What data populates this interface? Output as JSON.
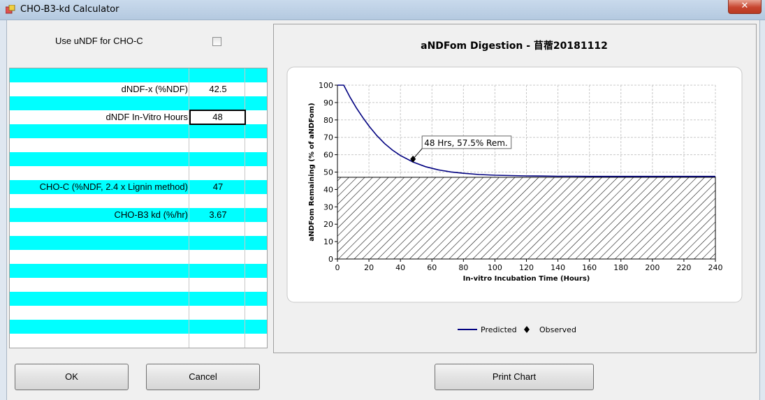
{
  "window": {
    "title": "CHO-B3-kd Calculator",
    "close_glyph": "✕"
  },
  "options": {
    "use_undf_label": "Use uNDF for CHO-C",
    "use_undf_checked": false
  },
  "grid": {
    "rows": [
      {
        "label": "",
        "value": ""
      },
      {
        "label": "dNDF-x (%NDF)",
        "value": "42.5"
      },
      {
        "label": "",
        "value": ""
      },
      {
        "label": "dNDF In-Vitro Hours",
        "value": "48"
      },
      {
        "label": "",
        "value": ""
      },
      {
        "label": "",
        "value": ""
      },
      {
        "label": "",
        "value": ""
      },
      {
        "label": "",
        "value": ""
      },
      {
        "label": "CHO-C (%NDF, 2.4 x Lignin method)",
        "value": "47"
      },
      {
        "label": "",
        "value": ""
      },
      {
        "label": "CHO-B3 kd (%/hr)",
        "value": "3.67"
      }
    ]
  },
  "chart_data": {
    "type": "line",
    "title": "aNDFom Digestion - 苜蓿20181112",
    "xlabel": "In-vitro Incubation Time (Hours)",
    "ylabel": "aNDFom Remaining (% of aNDFom)",
    "xlim": [
      0,
      240
    ],
    "ylim": [
      0,
      100
    ],
    "xticks": [
      0,
      20,
      40,
      60,
      80,
      100,
      120,
      140,
      160,
      180,
      200,
      220,
      240
    ],
    "yticks": [
      0,
      10,
      20,
      30,
      40,
      50,
      60,
      70,
      80,
      90,
      100
    ],
    "grid": true,
    "series": [
      {
        "name": "Predicted",
        "kind": "line",
        "color": "#000080",
        "x": [
          0,
          4,
          8,
          12,
          16,
          20,
          25,
          30,
          35,
          40,
          48,
          56,
          64,
          72,
          80,
          90,
          100,
          110,
          120,
          130,
          140,
          150,
          160,
          180,
          200,
          220,
          240
        ],
        "y": [
          100,
          100,
          93.1,
          87.0,
          81.5,
          76.5,
          71.0,
          66.4,
          62.6,
          59.5,
          55.8,
          53.1,
          51.3,
          50.1,
          49.3,
          48.6,
          48.2,
          48.0,
          47.8,
          47.7,
          47.6,
          47.6,
          47.5,
          47.5,
          47.5,
          47.5,
          47.5
        ]
      },
      {
        "name": "Observed",
        "kind": "scatter",
        "color": "#000000",
        "x": [
          48
        ],
        "y": [
          57.5
        ]
      }
    ],
    "annotation": {
      "text": "48 Hrs, 57.5% Rem.",
      "x": 48,
      "y": 57.5
    },
    "shaded_region": {
      "y_max": 47,
      "pattern": "diagonal-hatch"
    },
    "legend": {
      "position": "bottom",
      "entries": [
        "Predicted",
        "Observed"
      ]
    }
  },
  "buttons": {
    "ok": "OK",
    "cancel": "Cancel",
    "print_chart": "Print Chart"
  }
}
